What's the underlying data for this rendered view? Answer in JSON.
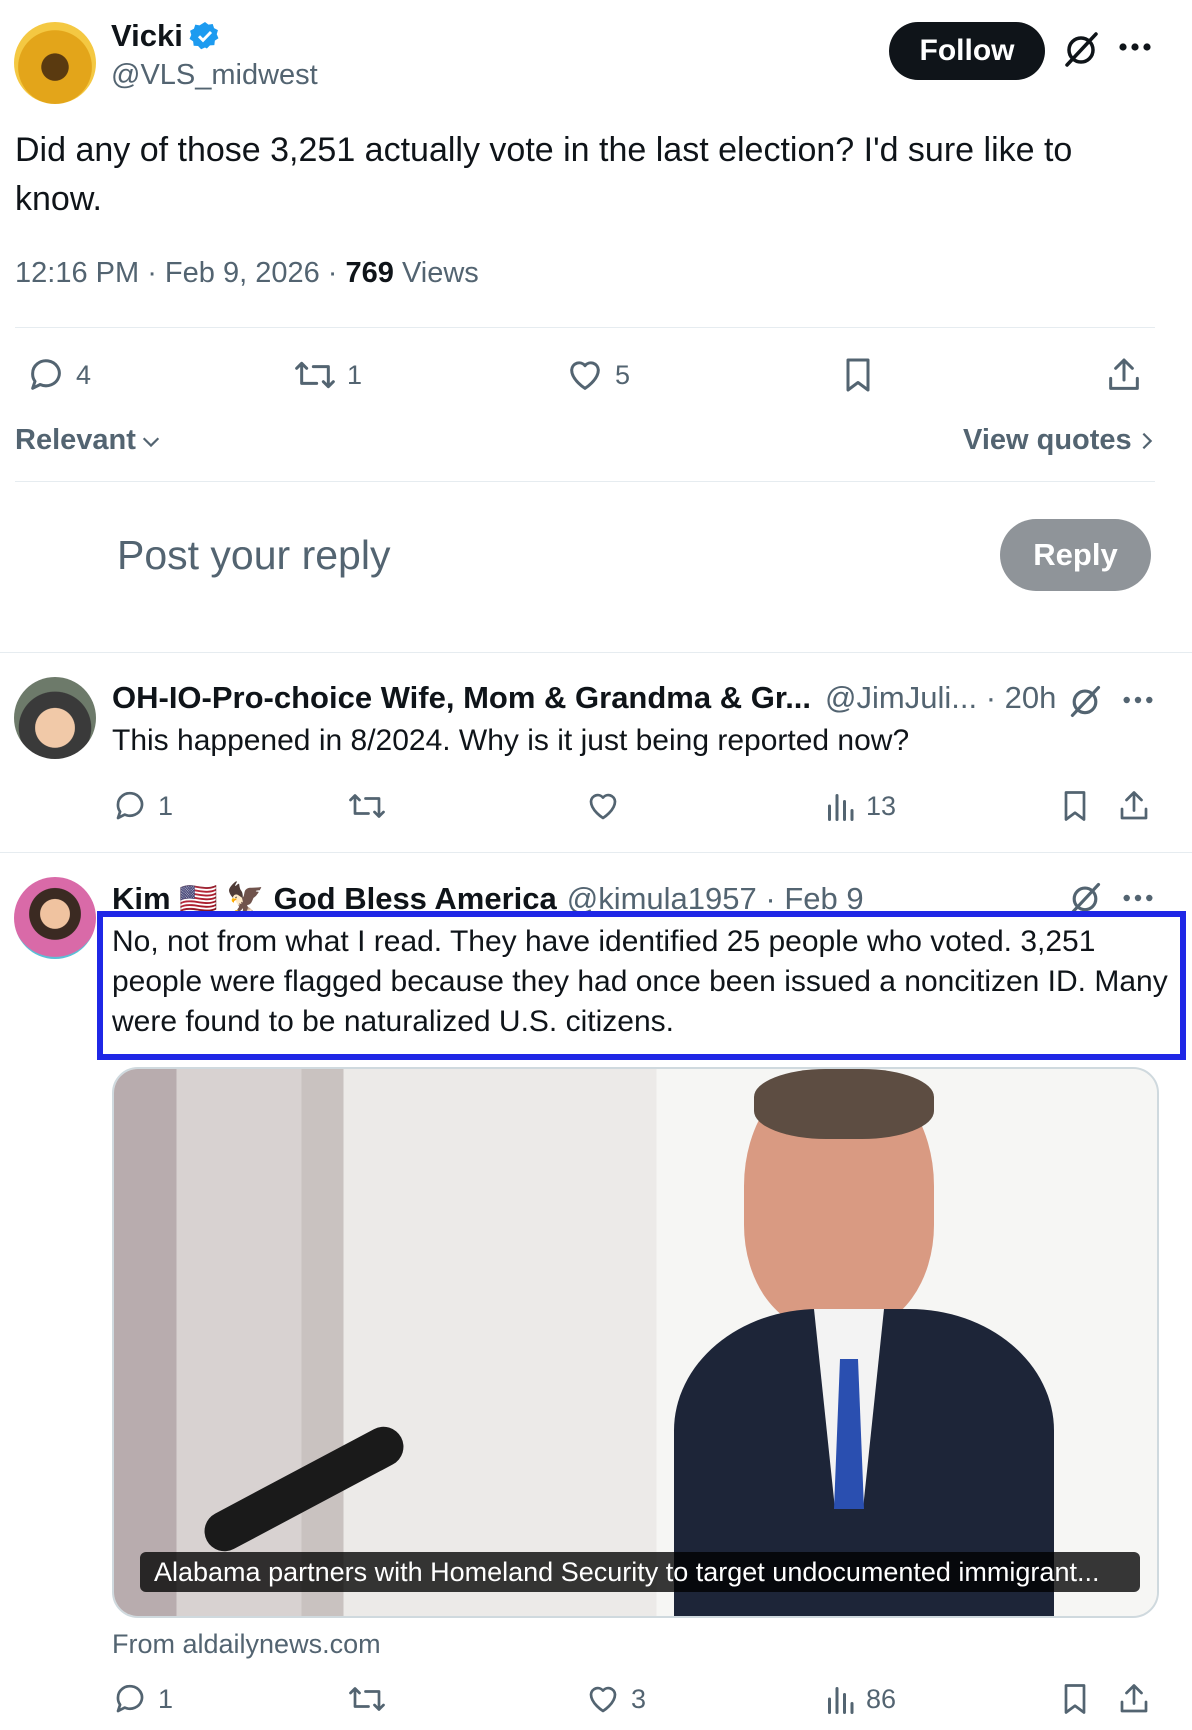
{
  "post": {
    "author_name": "Vicki",
    "author_handle": "@VLS_midwest",
    "follow_label": "Follow",
    "text": "Did any of those 3,251 actually vote in the last election?  I'd sure like to know.",
    "time": "12:16 PM",
    "date": "Feb 9, 2026",
    "views_count": "769",
    "views_label": "Views",
    "replies": "4",
    "reposts": "1",
    "likes": "5"
  },
  "sort": {
    "label": "Relevant",
    "view_quotes": "View quotes"
  },
  "composer": {
    "placeholder": "Post your reply",
    "reply_label": "Reply"
  },
  "replies": [
    {
      "name": "OH-IO-Pro-choice Wife, Mom & Grandma & Gr...",
      "handle": "@JimJuli...",
      "time": "20h",
      "text": "This happened in 8/2024. Why is it just being reported now?",
      "replies": "1",
      "views": "13"
    },
    {
      "name": "Kim 🇺🇸 🦅 God Bless America",
      "handle": "@kimula1957",
      "time": "Feb 9",
      "text": "No, not from what I read. They have identified 25 people who voted. 3,251 people were flagged because they had once been issued a noncitizen ID. Many were found to be naturalized U.S. citizens.",
      "card_caption": "Alabama partners with Homeland Security to target undocumented immigrant...",
      "card_source": "From aldailynews.com",
      "replies": "1",
      "likes": "3",
      "views": "86"
    }
  ],
  "colors": {
    "verified": "#1d9bf0",
    "highlight_box": "#1f27e6",
    "text_muted": "#536471"
  }
}
